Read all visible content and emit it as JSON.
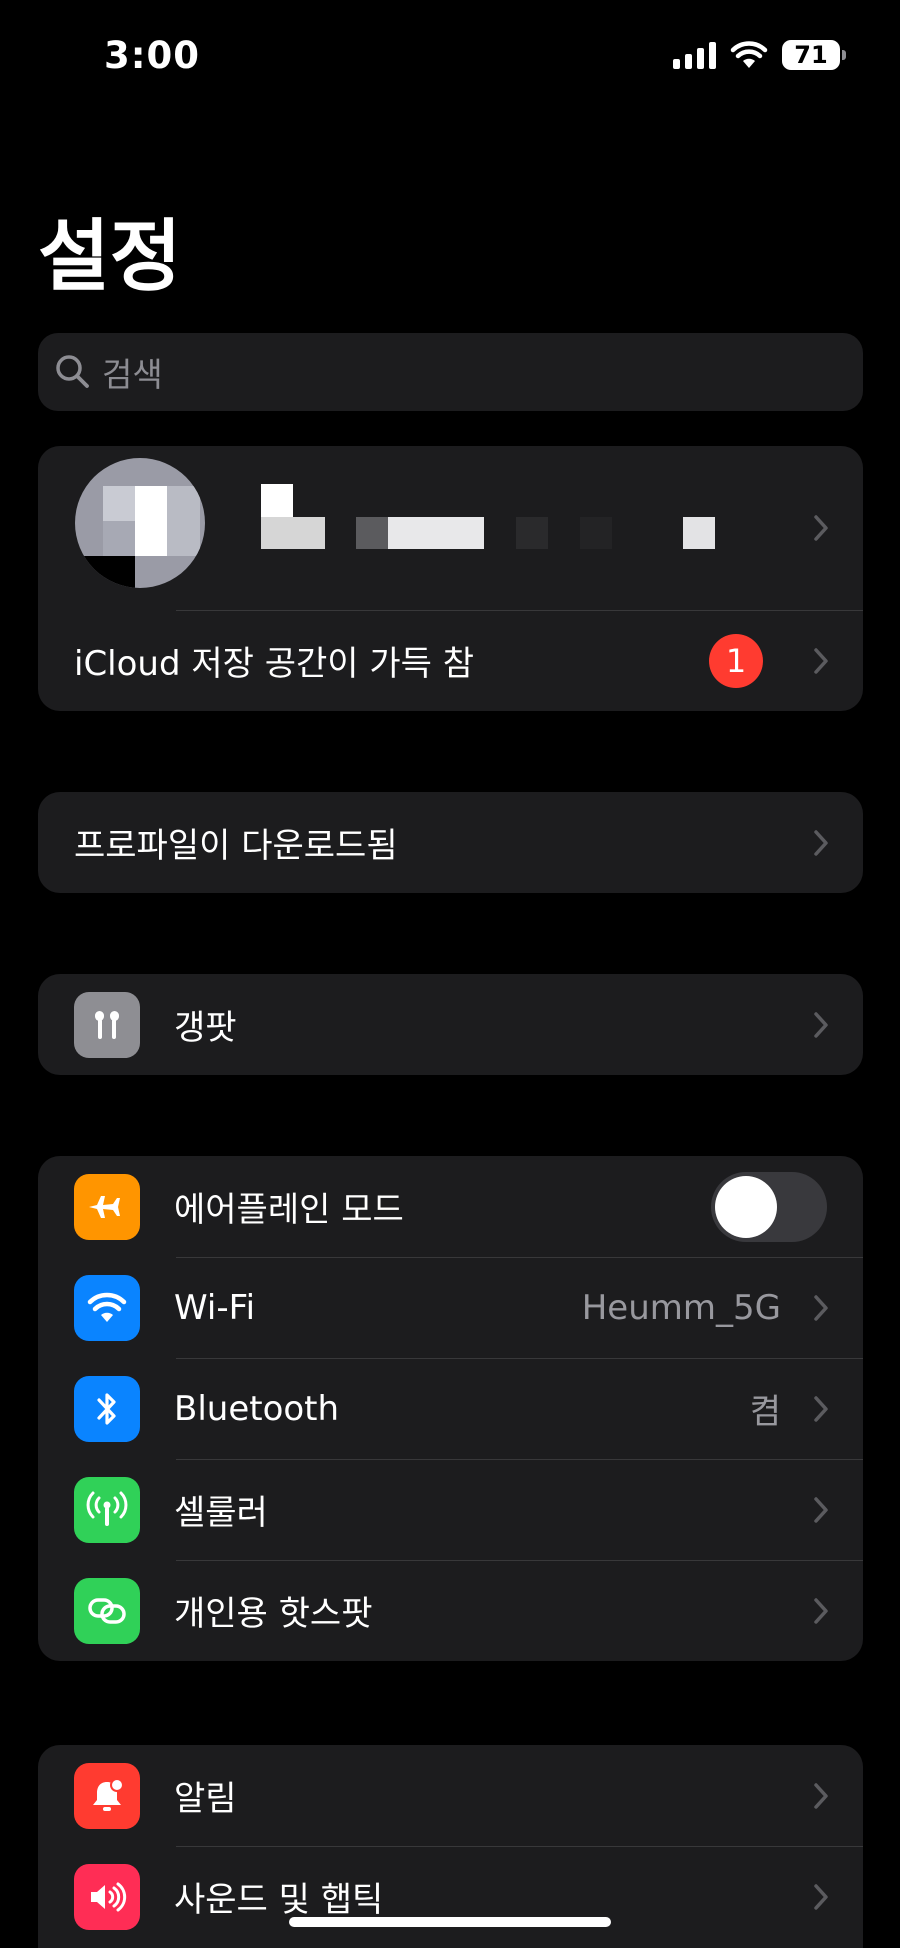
{
  "status_bar": {
    "time": "3:00",
    "battery": "71"
  },
  "page_title": "설정",
  "search": {
    "placeholder": "검색"
  },
  "account": {
    "storage_alert": "iCloud 저장 공간이 가득 참",
    "badge_count": "1"
  },
  "profile_download": {
    "label": "프로파일이 다운로드됨"
  },
  "device": {
    "label": "갱팟"
  },
  "connectivity": [
    {
      "label": "에어플레인 모드",
      "toggle": "off"
    },
    {
      "label": "Wi-Fi",
      "value": "Heumm_5G"
    },
    {
      "label": "Bluetooth",
      "value": "켬"
    },
    {
      "label": "셀룰러"
    },
    {
      "label": "개인용 핫스팟"
    }
  ],
  "notifications": [
    {
      "label": "알림"
    },
    {
      "label": "사운드 및 햅틱"
    }
  ],
  "colors": {
    "airplane": "#ff9500",
    "wifi": "#0a84ff",
    "bluetooth": "#0a84ff",
    "cellular": "#30d158",
    "hotspot": "#30d158",
    "notifications": "#ff3b30",
    "sounds": "#ff2d55",
    "device": "#8e8e93"
  }
}
